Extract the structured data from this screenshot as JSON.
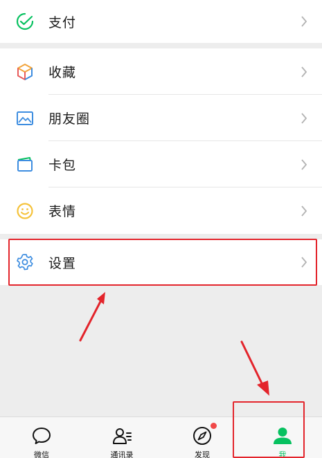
{
  "colors": {
    "accent": "#07c160",
    "highlight": "#e3242b",
    "badge": "#f04848"
  },
  "menu": {
    "pay": {
      "label": "支付",
      "icon": "pay-check-icon"
    },
    "favorites": {
      "label": "收藏",
      "icon": "cube-icon"
    },
    "moments": {
      "label": "朋友圈",
      "icon": "image-icon"
    },
    "cards": {
      "label": "卡包",
      "icon": "wallet-icon"
    },
    "stickers": {
      "label": "表情",
      "icon": "smiley-icon"
    },
    "settings": {
      "label": "设置",
      "icon": "gear-icon"
    }
  },
  "tabbar": {
    "chats": {
      "label": "微信",
      "icon": "chat-bubble-icon"
    },
    "contacts": {
      "label": "通讯录",
      "icon": "contacts-icon"
    },
    "discover": {
      "label": "发现",
      "icon": "compass-icon",
      "badge": true
    },
    "me": {
      "label": "我",
      "icon": "person-icon",
      "active": true
    }
  }
}
